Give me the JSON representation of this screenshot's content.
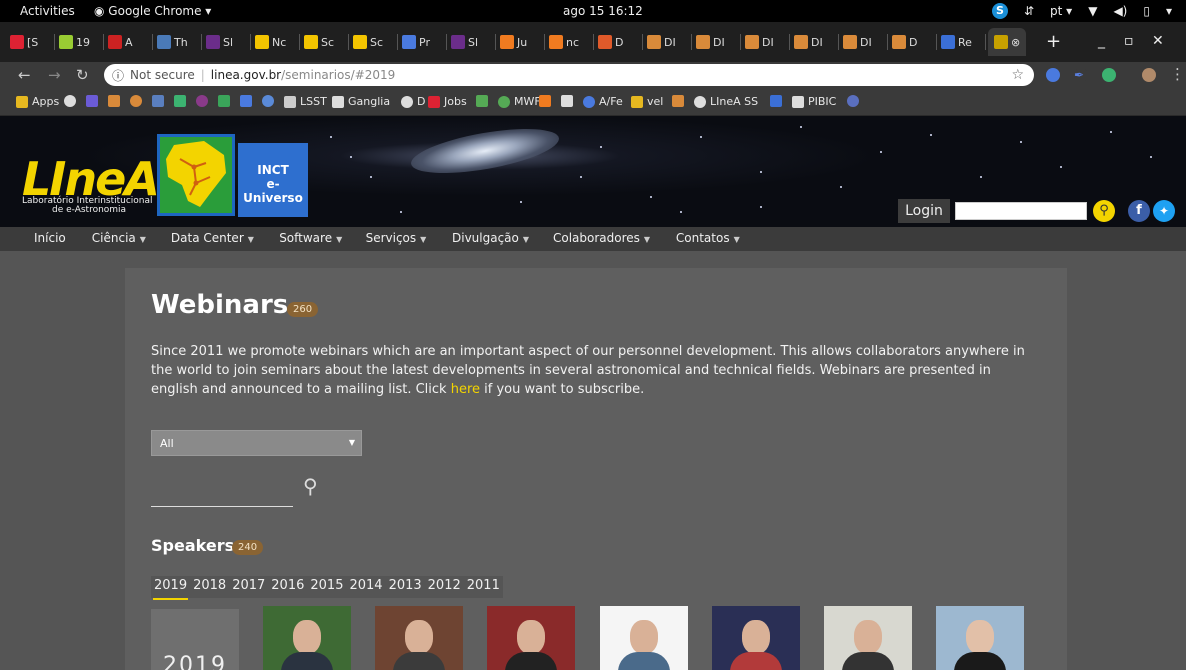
{
  "os_bar": {
    "activities": "Activities",
    "app_name": "Google Chrome ▾",
    "clock": "ago 15 16:12",
    "lang": "pt ▾"
  },
  "tabs": [
    {
      "label": "[S",
      "icon_color": "#d23"
    },
    {
      "label": "19",
      "icon_color": "#9c3"
    },
    {
      "label": "A",
      "icon_color": "#c22"
    },
    {
      "label": "Th",
      "icon_color": "#4a7ab8"
    },
    {
      "label": "Sl",
      "icon_color": "#6b2d8a"
    },
    {
      "label": "Nc",
      "icon_color": "#f3c400"
    },
    {
      "label": "Sc",
      "icon_color": "#f3c400"
    },
    {
      "label": "Sc",
      "icon_color": "#f3c400"
    },
    {
      "label": "Pr",
      "icon_color": "#4a7adf"
    },
    {
      "label": "Sl",
      "icon_color": "#6b2d8a"
    },
    {
      "label": "Ju",
      "icon_color": "#f07b20"
    },
    {
      "label": "nc",
      "icon_color": "#f07b20"
    },
    {
      "label": "D",
      "icon_color": "#e05a2a"
    },
    {
      "label": "DI",
      "icon_color": "#d98a3a"
    },
    {
      "label": "DI",
      "icon_color": "#d98a3a"
    },
    {
      "label": "DI",
      "icon_color": "#d98a3a"
    },
    {
      "label": "DI",
      "icon_color": "#d98a3a"
    },
    {
      "label": "DI",
      "icon_color": "#d98a3a"
    },
    {
      "label": "D",
      "icon_color": "#d98a3a"
    },
    {
      "label": "Re",
      "icon_color": "#3b6fd6"
    }
  ],
  "address_bar": {
    "security": "Not secure",
    "host": "linea.gov.br",
    "path": "/seminarios/#2019"
  },
  "bookmarks": [
    {
      "label": "Apps",
      "icon_color": "#e6b820"
    },
    {
      "label": "",
      "icon_color": "#ddd"
    },
    {
      "label": "",
      "icon_color": "#6b5bd6"
    },
    {
      "label": "",
      "icon_color": "#d98a3a"
    },
    {
      "label": "",
      "icon_color": "#d98a3a"
    },
    {
      "label": "",
      "icon_color": "#5a7fbf"
    },
    {
      "label": "",
      "icon_color": "#3cb371"
    },
    {
      "label": "",
      "icon_color": "#8a3a8a"
    },
    {
      "label": "",
      "icon_color": "#3aa55a"
    },
    {
      "label": "",
      "icon_color": "#4a7adf"
    },
    {
      "label": "",
      "icon_color": "#5a8ad8"
    },
    {
      "label": "LSST",
      "icon_color": "#ccc"
    },
    {
      "label": "Ganglia",
      "icon_color": "#ddd"
    },
    {
      "label": "D",
      "icon_color": "#ddd"
    },
    {
      "label": "Jobs",
      "icon_color": "#d23"
    },
    {
      "label": "",
      "icon_color": "#5a5"
    },
    {
      "label": "MWF",
      "icon_color": "#5a5"
    },
    {
      "label": "",
      "icon_color": "#f07b20"
    },
    {
      "label": "",
      "icon_color": "#ddd"
    },
    {
      "label": "A/Fe",
      "icon_color": "#4a7adf"
    },
    {
      "label": "vel",
      "icon_color": "#e6b820"
    },
    {
      "label": "",
      "icon_color": "#d98a3a"
    },
    {
      "label": "LIneA SS",
      "icon_color": "#ddd"
    },
    {
      "label": "",
      "icon_color": "#3b6fd6"
    },
    {
      "label": "PIBIC",
      "icon_color": "#ddd"
    },
    {
      "label": "",
      "icon_color": "#5a6fbf"
    }
  ],
  "site": {
    "logo_word": "LIneA",
    "logo_sub1": "Laboratório Interinstitucional",
    "logo_sub2": "de e-Astronomia",
    "inct_line1": "INCT",
    "inct_line2": "e-Universo",
    "login": "Login",
    "search_value": "",
    "nav": [
      {
        "label": "Início",
        "dropdown": false
      },
      {
        "label": "Ciência",
        "dropdown": true
      },
      {
        "label": "Data Center",
        "dropdown": true
      },
      {
        "label": "Software",
        "dropdown": true
      },
      {
        "label": "Serviços",
        "dropdown": true
      },
      {
        "label": "Divulgação",
        "dropdown": true
      },
      {
        "label": "Colaboradores",
        "dropdown": true
      },
      {
        "label": "Contatos",
        "dropdown": true
      }
    ]
  },
  "content": {
    "title": "Webinars",
    "title_count": "260",
    "desc_before": "Since 2011 we promote webinars which are an important aspect of our personnel development. This allows collaborators anywhere in the world to join seminars about the latest developments in several astronomical and technical fields. Webinars are presented in english and announced to a mailing list. Click ",
    "desc_link": "here",
    "desc_after": " if you want to subscribe.",
    "filter_selected": "All",
    "search_value": "",
    "speakers_label": "Speakers",
    "speakers_count": "240",
    "years": [
      "2019",
      "2018",
      "2017",
      "2016",
      "2015",
      "2014",
      "2013",
      "2012",
      "2011"
    ],
    "active_year": "2019",
    "year_card": "2019"
  },
  "colors": {
    "accent_yellow": "#f3d400",
    "badge_brown": "#8a6433",
    "panel_gray": "#5f5f5f"
  }
}
